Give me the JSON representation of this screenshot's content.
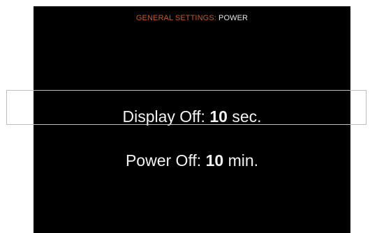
{
  "header": {
    "section": "GENERAL SETTINGS:",
    "page": "POWER"
  },
  "settings": [
    {
      "label": "Display Off:",
      "value": "10",
      "unit": "sec.",
      "selected": true
    },
    {
      "label": "Power Off:",
      "value": "10",
      "unit": "min.",
      "selected": false
    }
  ],
  "colors": {
    "background": "#000000",
    "breadcrumb_parent": "#c25a2c",
    "breadcrumb_current": "#e6e6e6",
    "text": "#f2f2f2",
    "selection_border": "#bdbdbd"
  }
}
